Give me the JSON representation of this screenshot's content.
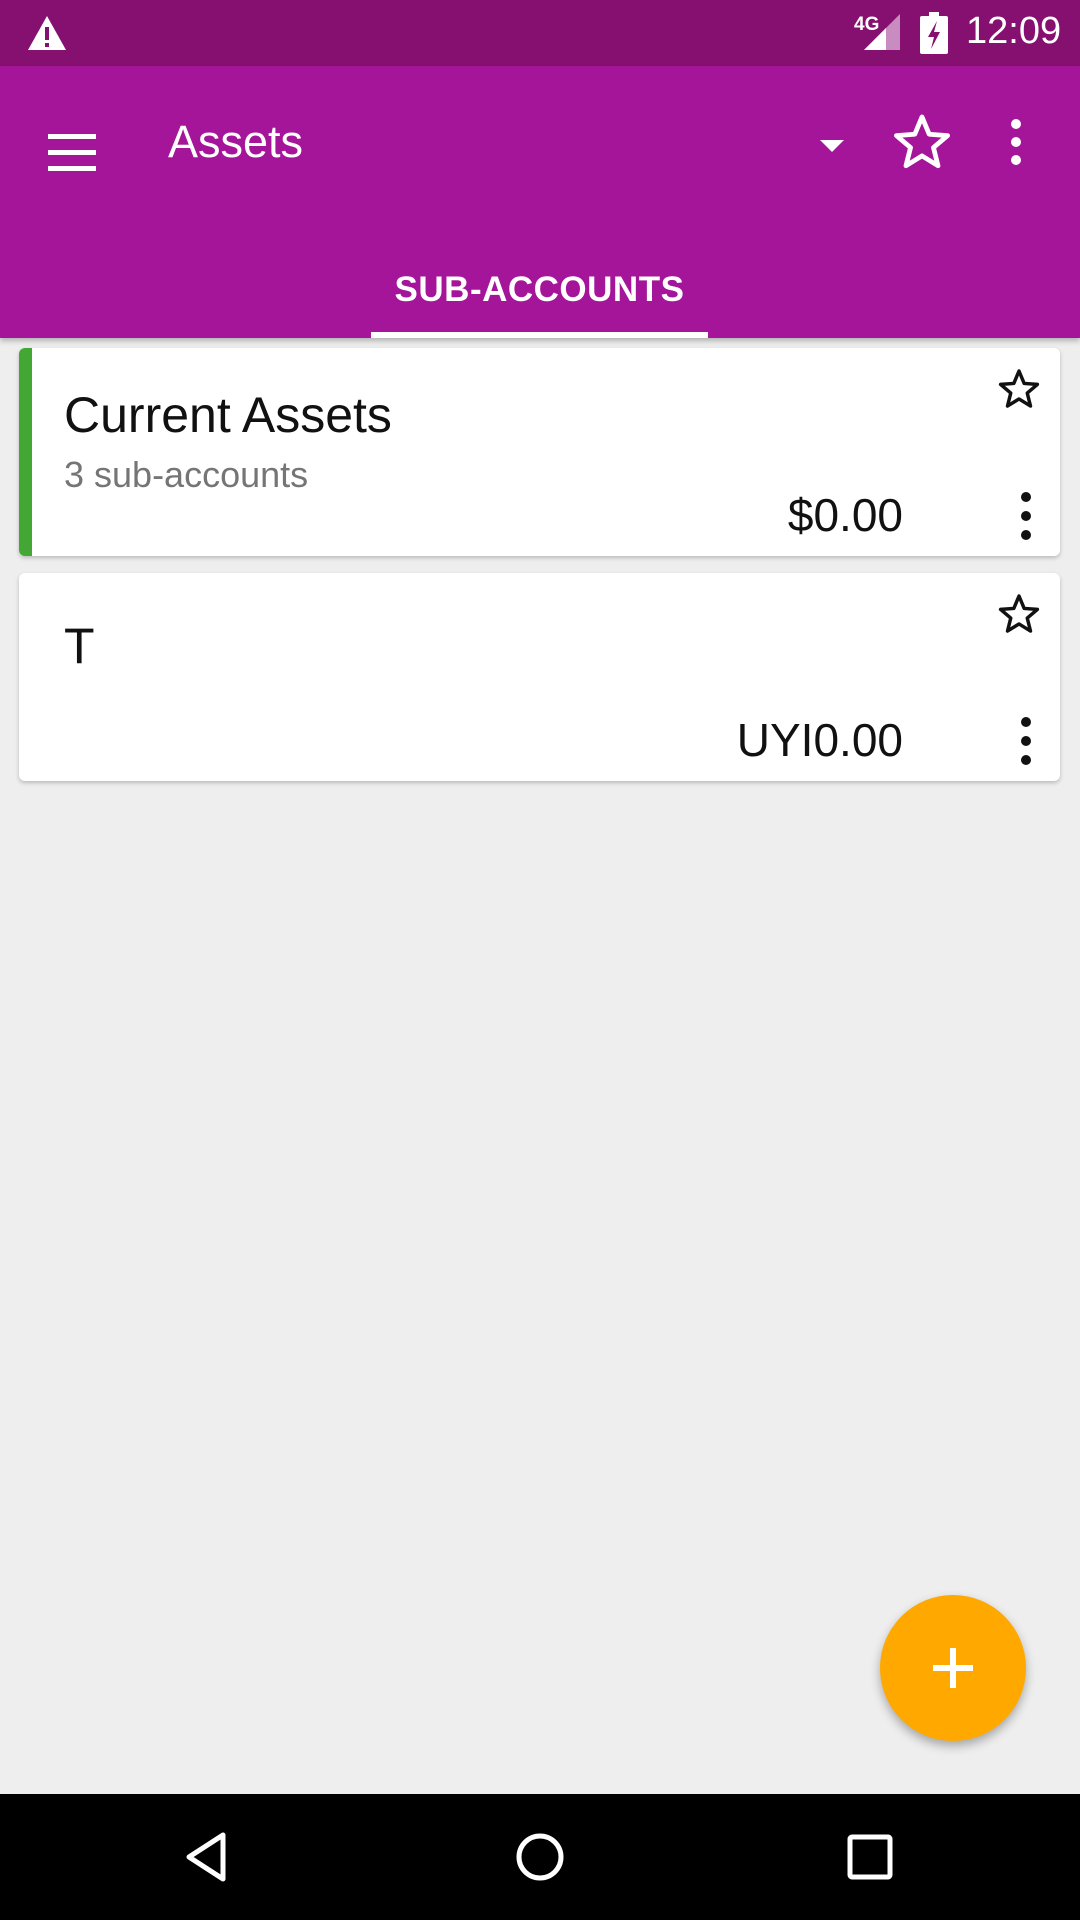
{
  "status_bar": {
    "network_label": "4G",
    "time": "12:09"
  },
  "app_bar": {
    "title": "Assets",
    "tabs": [
      {
        "label": "SUB-ACCOUNTS",
        "selected": true
      }
    ]
  },
  "accounts": [
    {
      "name": "Current Assets",
      "subtitle": "3 sub-accounts",
      "balance": "$0.00",
      "color": "#43a833",
      "favorite": false
    },
    {
      "name": "T",
      "subtitle": "",
      "balance": "UYI0.00",
      "favorite": false
    }
  ],
  "colors": {
    "status_bar": "#86106f",
    "app_bar": "#a4159a",
    "fab": "#ffa800",
    "background": "#eeeeee"
  },
  "icons": {
    "status": [
      "warning-icon",
      "cell-signal-icon",
      "battery-charging-icon"
    ],
    "app_bar": [
      "menu-icon",
      "dropdown-arrow-icon",
      "star-outline-icon",
      "more-vert-icon"
    ],
    "card": [
      "star-outline-icon",
      "more-vert-icon"
    ],
    "fab": "plus-icon",
    "nav": [
      "back-icon",
      "home-icon",
      "recents-icon"
    ]
  }
}
